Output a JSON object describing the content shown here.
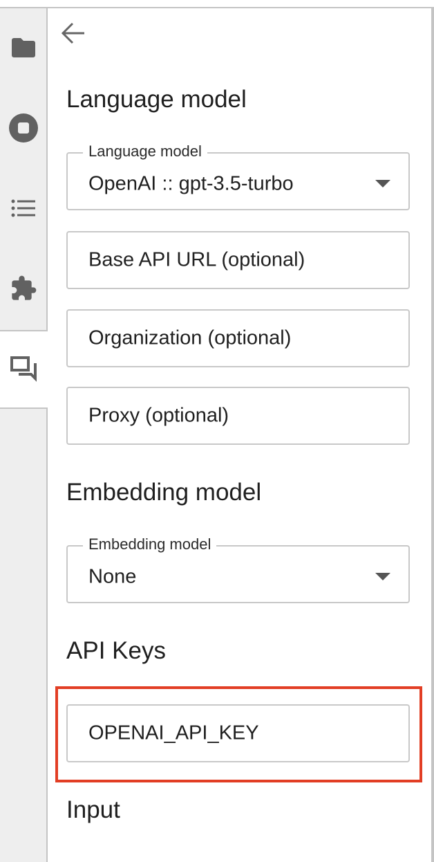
{
  "sidebar": {
    "tabs": [
      {
        "icon": "folder-icon"
      },
      {
        "icon": "stop-circle-icon"
      },
      {
        "icon": "list-icon"
      },
      {
        "icon": "extension-puzzle-icon"
      },
      {
        "icon": "chat-icon",
        "active": true
      }
    ]
  },
  "header": {
    "back_icon": "arrow-left-icon"
  },
  "language_model": {
    "heading": "Language model",
    "select_label": "Language model",
    "select_value": "OpenAI :: gpt-3.5-turbo",
    "base_api_url_placeholder": "Base API URL (optional)",
    "organization_placeholder": "Organization (optional)",
    "proxy_placeholder": "Proxy (optional)"
  },
  "embedding_model": {
    "heading": "Embedding model",
    "select_label": "Embedding model",
    "select_value": "None"
  },
  "api_keys": {
    "heading": "API Keys",
    "openai_key_label": "OPENAI_API_KEY"
  },
  "input": {
    "heading": "Input"
  },
  "colors": {
    "highlight": "#e23e24",
    "sidebar_bg": "#eeeeee",
    "icon": "#616161"
  }
}
